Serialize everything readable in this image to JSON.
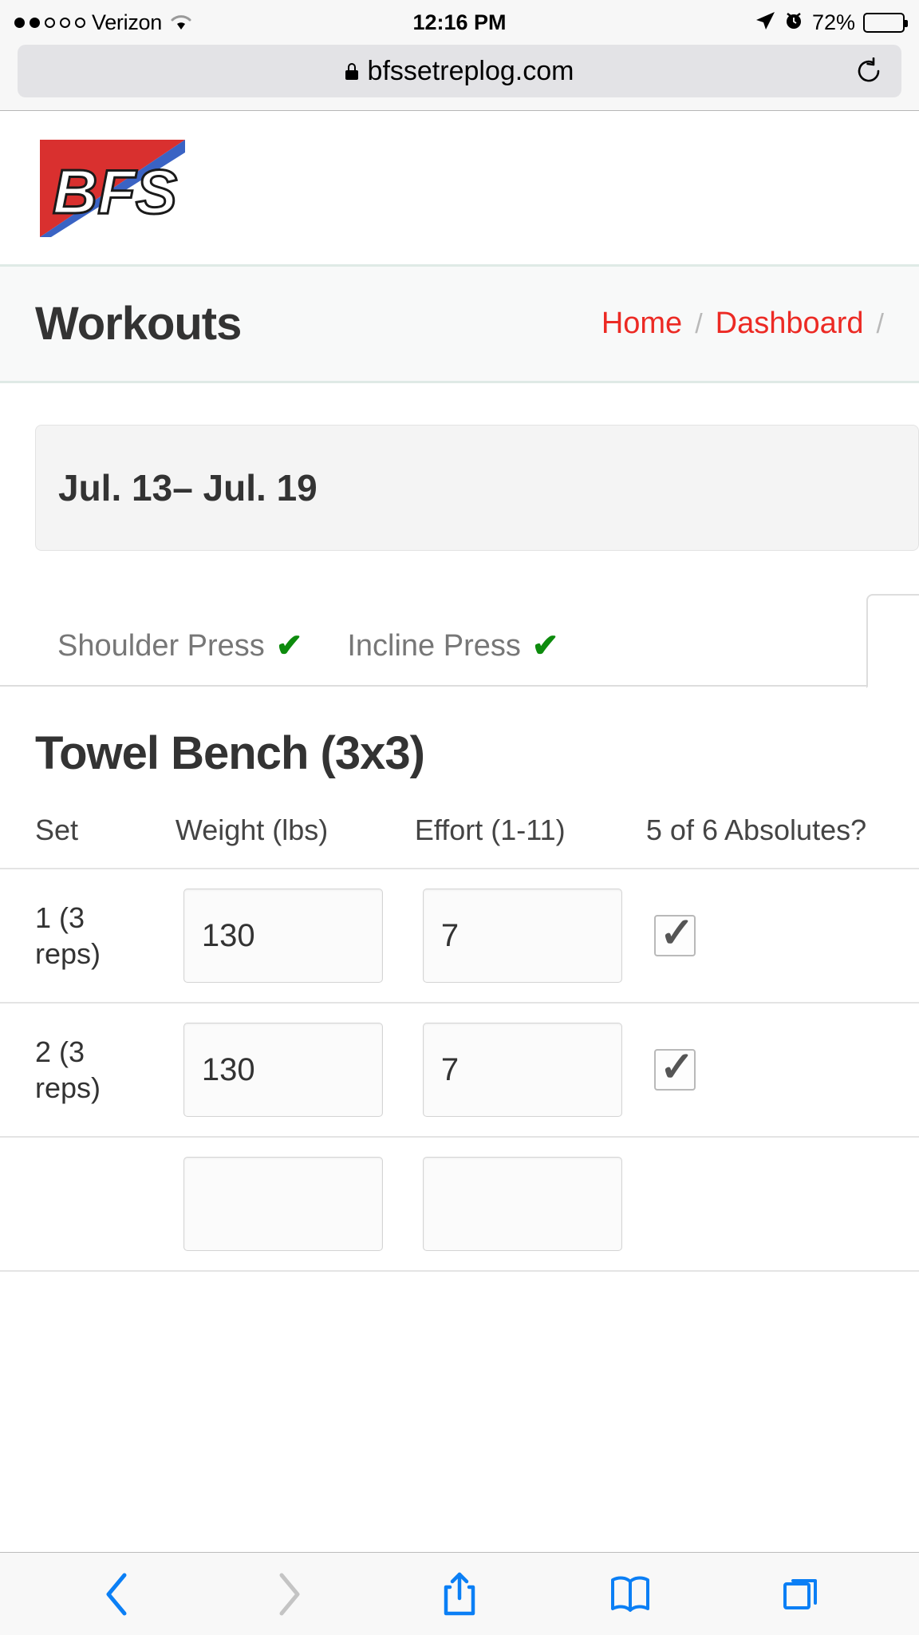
{
  "status_bar": {
    "carrier": "Verizon",
    "signal_dots_filled": 2,
    "signal_dots_total": 5,
    "time": "12:16 PM",
    "battery_percent": "72%",
    "battery_level": 72,
    "icons": [
      "location-arrow-icon",
      "alarm-clock-icon",
      "wifi-icon"
    ]
  },
  "browser": {
    "url": "bfssetreplog.com",
    "lock_icon": "lock-icon",
    "reload_icon": "reload-icon",
    "toolbar": {
      "back": "back-icon",
      "forward": "forward-icon",
      "share": "share-icon",
      "bookmarks": "bookmarks-icon",
      "tabs": "tabs-icon"
    }
  },
  "site": {
    "logo_text": "BFS",
    "logo_colors": {
      "red": "#d9302f",
      "blue": "#3a63c4",
      "letter": "#ffffff"
    }
  },
  "header": {
    "title": "Workouts",
    "breadcrumb": [
      {
        "label": "Home",
        "type": "link"
      },
      {
        "label": "/",
        "type": "separator"
      },
      {
        "label": "Dashboard",
        "type": "link"
      },
      {
        "label": "/",
        "type": "separator"
      }
    ],
    "link_color": "#ec2a24"
  },
  "date_range": {
    "label": "Jul. 13– Jul. 19"
  },
  "tabs": [
    {
      "label": "Shoulder Press",
      "completed": true,
      "check": "✔",
      "active": false
    },
    {
      "label": "Incline Press",
      "completed": true,
      "check": "✔",
      "active": false
    },
    {
      "label": "",
      "completed": false,
      "check": "",
      "active": true
    }
  ],
  "exercise": {
    "title": "Towel Bench (3x3)",
    "table": {
      "headers": [
        "Set",
        "Weight (lbs)",
        "Effort (1-11)",
        "5 of 6 Absolutes?"
      ],
      "rows": [
        {
          "set": "1 (3 reps)",
          "weight": "130",
          "effort": "7",
          "absolutes_checked": true,
          "check_mark": "✓"
        },
        {
          "set": "2 (3 reps)",
          "weight": "130",
          "effort": "7",
          "absolutes_checked": true,
          "check_mark": "✓"
        },
        {
          "set": "",
          "weight": "",
          "effort": "",
          "absolutes_checked": false,
          "check_mark": ""
        }
      ]
    }
  }
}
